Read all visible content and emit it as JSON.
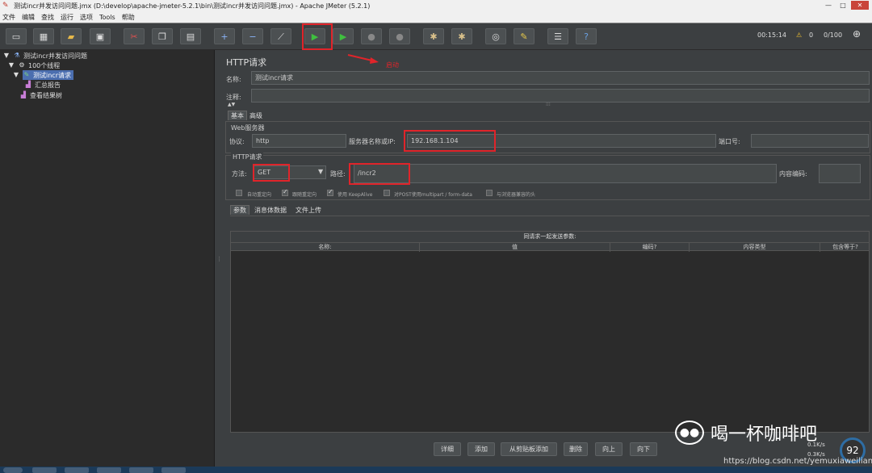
{
  "window": {
    "title": "测试incr并发访问问题.jmx (D:\\develop\\apache-jmeter-5.2.1\\bin\\测试incr并发访问问题.jmx) - Apache JMeter (5.2.1)"
  },
  "menu": [
    "文件",
    "编辑",
    "查找",
    "运行",
    "选项",
    "Tools",
    "帮助"
  ],
  "toolbar": {
    "timer": "00:15:14",
    "warnings": "0",
    "threads": "0/100",
    "icons": [
      "new-icon",
      "templates-icon",
      "open-icon",
      "save-icon",
      "cut-icon",
      "copy-icon",
      "paste-icon",
      "expand-icon",
      "collapse-icon",
      "toggle-icon",
      "start-icon",
      "start-no-pause-icon",
      "stop-icon",
      "shutdown-icon",
      "clear-icon",
      "clear-all-icon",
      "search-icon",
      "reset-search-icon",
      "function-helper-icon",
      "help-icon"
    ]
  },
  "tree": {
    "root": "测试incr并发访问问题",
    "thread_group": "100个线程",
    "sampler": "测试incr请求",
    "listener1": "汇总报告",
    "listener2": "查看结果树"
  },
  "panel": {
    "title": "HTTP请求",
    "name_label": "名称:",
    "name_value": "测试incr请求",
    "comment_label": "注释:",
    "tabs": [
      "基本",
      "高级"
    ],
    "web_server_title": "Web服务器",
    "protocol_label": "协议:",
    "protocol_value": "http",
    "server_label": "服务器名称或IP:",
    "server_value": "192.168.1.104",
    "port_label": "端口号:",
    "http_request_title": "HTTP请求",
    "method_label": "方法:",
    "method_value": "GET",
    "path_label": "路径:",
    "path_value": "/incr2",
    "encoding_label": "内容编码:",
    "checkboxes": [
      {
        "label": "自动重定向",
        "checked": false
      },
      {
        "label": "跟随重定向",
        "checked": true
      },
      {
        "label": "使用 KeepAlive",
        "checked": true
      },
      {
        "label": "对POST使用multipart / form-data",
        "checked": false
      },
      {
        "label": "与浏览器兼容的头",
        "checked": false
      }
    ],
    "subtabs": [
      "参数",
      "消息体数据",
      "文件上传"
    ],
    "table_caption": "同请求一起发送参数:",
    "columns": [
      "名称:",
      "值",
      "编码?",
      "内容类型",
      "包含等于?"
    ],
    "buttons": [
      "详细",
      "添加",
      "从剪贴板添加",
      "删除",
      "向上",
      "向下"
    ]
  },
  "annotation": "启动",
  "watermark": {
    "text": "喝一杯咖啡吧",
    "url": "https://blog.csdn.net/yemuxiaweiliang",
    "percent": "92",
    "up": "0.1K/s",
    "down": "0.3K/s"
  },
  "colors": {
    "highlight": "#e0242a",
    "selection": "#4b6eaf"
  }
}
